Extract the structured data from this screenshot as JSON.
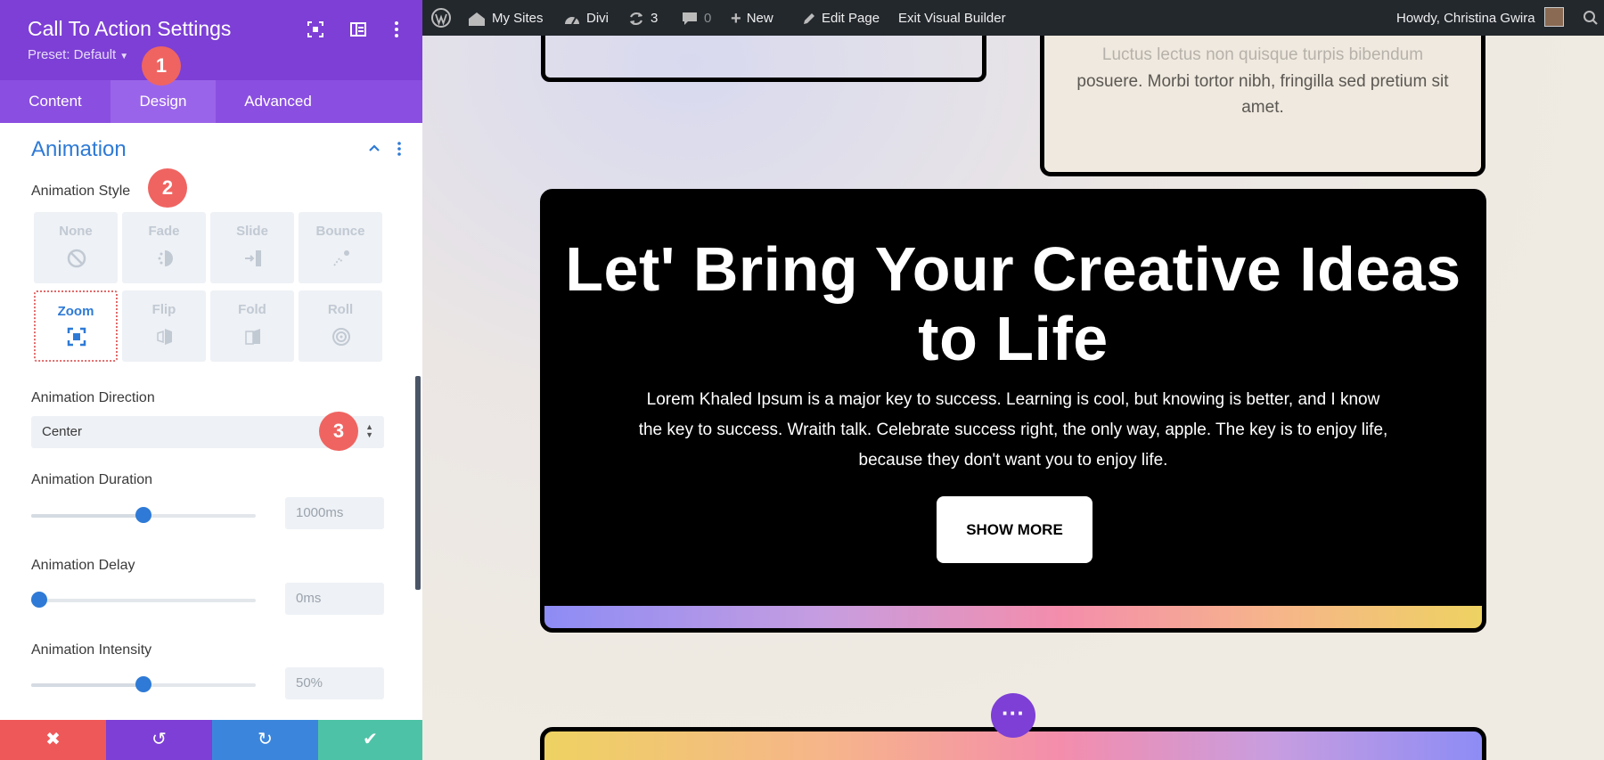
{
  "panel": {
    "title": "Call To Action Settings",
    "preset": "Preset: Default",
    "tabs": [
      "Content",
      "Design",
      "Advanced"
    ],
    "active_tab": "Design",
    "section_title": "Animation",
    "animation_style_label": "Animation Style",
    "styles": [
      {
        "label": "None",
        "icon": "none-icon"
      },
      {
        "label": "Fade",
        "icon": "fade-icon"
      },
      {
        "label": "Slide",
        "icon": "slide-icon"
      },
      {
        "label": "Bounce",
        "icon": "bounce-icon"
      },
      {
        "label": "Zoom",
        "icon": "zoom-icon"
      },
      {
        "label": "Flip",
        "icon": "flip-icon"
      },
      {
        "label": "Fold",
        "icon": "fold-icon"
      },
      {
        "label": "Roll",
        "icon": "roll-icon"
      }
    ],
    "selected_style": "Zoom",
    "direction_label": "Animation Direction",
    "direction_value": "Center",
    "duration_label": "Animation Duration",
    "duration_value": "1000ms",
    "duration_fraction": 0.5,
    "delay_label": "Animation Delay",
    "delay_value": "0ms",
    "delay_fraction": 0.0,
    "intensity_label": "Animation Intensity",
    "intensity_value": "50%",
    "intensity_fraction": 0.5,
    "badges": [
      "1",
      "2",
      "3"
    ],
    "footer_buttons": [
      {
        "name": "cancel-button",
        "icon": "✖",
        "color": "#ef5858"
      },
      {
        "name": "undo-button",
        "icon": "↺",
        "color": "#7d3fd5"
      },
      {
        "name": "redo-button",
        "icon": "↻",
        "color": "#3b86dc"
      },
      {
        "name": "save-button",
        "icon": "✔",
        "color": "#4ec2a6"
      }
    ],
    "colors": {
      "header": "#7d3fd5",
      "accent": "#2e7ad6",
      "badge": "#ef6461"
    }
  },
  "adminbar": {
    "my_sites": "My Sites",
    "divi": "Divi",
    "updates_count": "3",
    "comments_count": "0",
    "new": "New",
    "edit_page": "Edit Page",
    "exit_builder": "Exit Visual Builder",
    "howdy": "Howdy, Christina Gwira"
  },
  "page": {
    "top_right_faded": "Luctus lectus non quisque turpis bibendum",
    "top_right_text": "posuere. Morbi tortor nibh, fringilla sed pretium sit amet.",
    "cta_title": "Let' Bring Your Creative Ideas to Life",
    "cta_body": "Lorem Khaled Ipsum is a major key to success. Learning is cool, but knowing is better, and I know the key to success. Wraith talk. Celebrate success right, the only way, apple. The key is to enjoy life, because they don't want you to enjoy life.",
    "cta_button": "SHOW MORE",
    "dots": "···"
  }
}
